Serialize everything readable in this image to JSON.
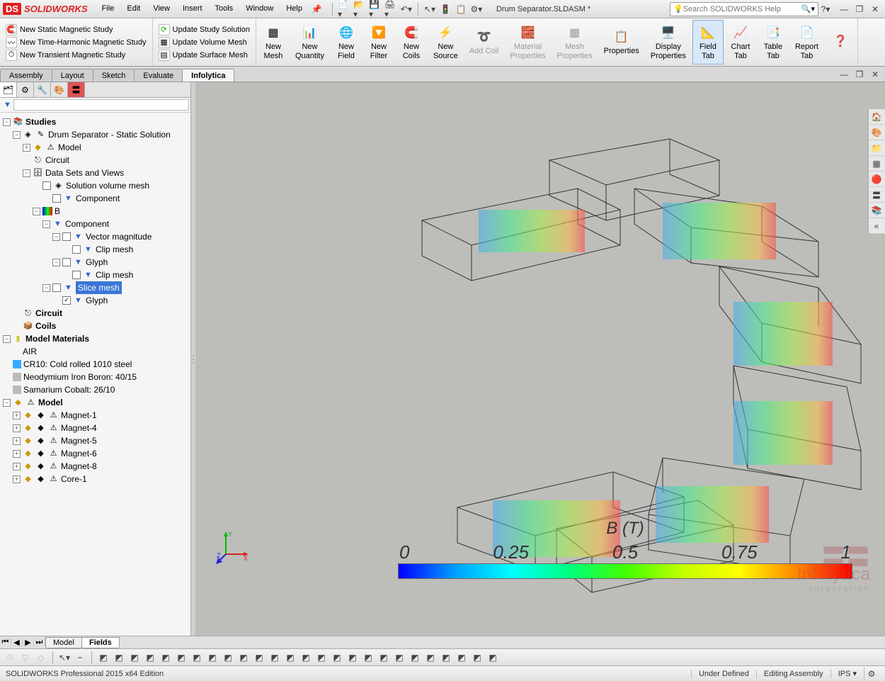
{
  "app": {
    "brand_prefix": "DS",
    "brand": "SOLIDWORKS"
  },
  "menu": [
    "File",
    "Edit",
    "View",
    "Insert",
    "Tools",
    "Window",
    "Help"
  ],
  "document_title": "Drum Separator.SLDASM *",
  "search_placeholder": "Search SOLIDWORKS Help",
  "ribbon": {
    "group1": [
      {
        "icon": "🧲",
        "label": "New Static Magnetic Study"
      },
      {
        "icon": "〰️",
        "label": "New Time-Harmonic Magnetic Study"
      },
      {
        "icon": "⏱️",
        "label": "New Transient Magnetic Study"
      }
    ],
    "group2": [
      {
        "icon": "🔄",
        "label": "Update Study Solution"
      },
      {
        "icon": "▦",
        "label": "Update Volume Mesh"
      },
      {
        "icon": "▤",
        "label": "Update Surface Mesh"
      }
    ],
    "buttons": [
      {
        "icon": "▦",
        "label": "New\nMesh"
      },
      {
        "icon": "📊",
        "label": "New\nQuantity"
      },
      {
        "icon": "🌐",
        "label": "New\nField"
      },
      {
        "icon": "🔽",
        "label": "New\nFilter"
      },
      {
        "icon": "🧲",
        "label": "New\nCoils"
      },
      {
        "icon": "⚡",
        "label": "New\nSource"
      },
      {
        "icon": "➰",
        "label": "Add Coil",
        "disabled": true
      },
      {
        "icon": "🧱",
        "label": "Material\nProperties",
        "disabled": true
      },
      {
        "icon": "▦",
        "label": "Mesh\nProperties",
        "disabled": true
      },
      {
        "icon": "📋",
        "label": "Properties"
      },
      {
        "icon": "🖥️",
        "label": "Display\nProperties"
      },
      {
        "icon": "📐",
        "label": "Field\nTab",
        "active": true
      },
      {
        "icon": "📈",
        "label": "Chart\nTab"
      },
      {
        "icon": "📑",
        "label": "Table\nTab"
      },
      {
        "icon": "📄",
        "label": "Report\nTab"
      },
      {
        "icon": "❓",
        "label": ""
      }
    ]
  },
  "tabs": [
    "Assembly",
    "Layout",
    "Sketch",
    "Evaluate",
    "Infolytica"
  ],
  "active_tab": "Infolytica",
  "tree": {
    "root": "Studies",
    "study": "Drum Separator - Static Solution",
    "model": "Model",
    "circuit": "Circuit",
    "datasets": "Data Sets and Views",
    "solmesh": "Solution volume mesh",
    "component1": "Component",
    "b_field": "B",
    "component2": "Component",
    "vecmag": "Vector magnitude",
    "clip1": "Clip mesh",
    "glyph1": "Glyph",
    "clip2": "Clip mesh",
    "slice": "Slice mesh",
    "glyph2": "Glyph",
    "circuit2": "Circuit",
    "coils": "Coils",
    "materials": "Model Materials",
    "mat_air": "AIR",
    "mat_steel": "CR10: Cold rolled 1010 steel",
    "mat_neo": "Neodymium Iron Boron: 40/15",
    "mat_sam": "Samarium Cobalt: 26/10",
    "model2": "Model",
    "magnets": [
      "Magnet-1",
      "Magnet-4",
      "Magnet-5",
      "Magnet-6",
      "Magnet-8",
      "Core-1"
    ]
  },
  "legend": {
    "title": "B (T)",
    "ticks": [
      "0",
      "0.25",
      "0.5",
      "0.75",
      "1"
    ]
  },
  "watermark": {
    "name": "infolytica",
    "sub": "corporation"
  },
  "bottom_tabs": [
    "Model",
    "Fields"
  ],
  "status": {
    "edition": "SOLIDWORKS Professional 2015 x64 Edition",
    "state": "Under Defined",
    "mode": "Editing Assembly",
    "units": "IPS"
  }
}
